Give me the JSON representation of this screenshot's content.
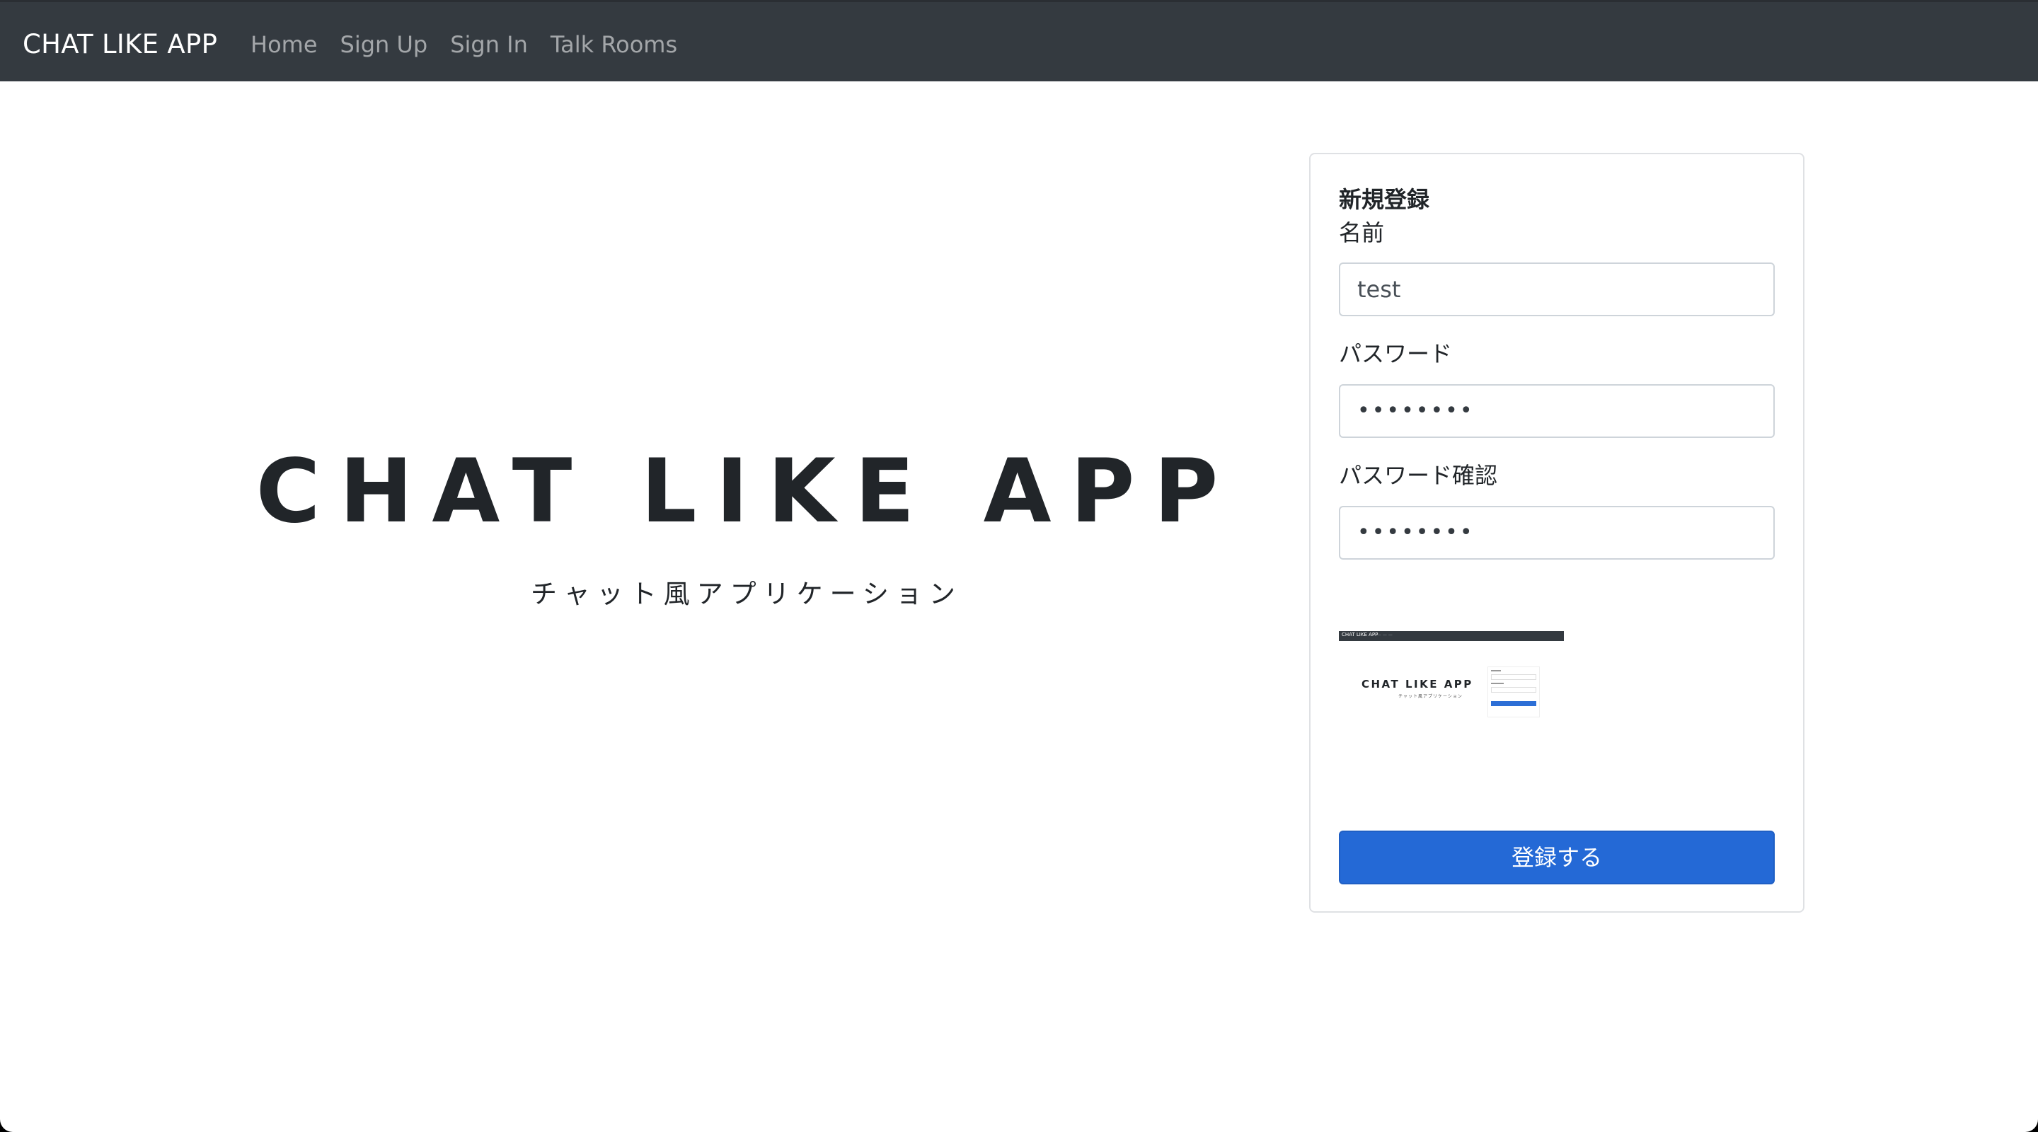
{
  "navbar": {
    "brand": "CHAT LIKE APP",
    "links": [
      "Home",
      "Sign Up",
      "Sign In",
      "Talk Rooms"
    ]
  },
  "hero": {
    "title": "CHAT LIKE APP",
    "subtitle": "チャット風アプリケーション"
  },
  "signup_form": {
    "title": "新規登録",
    "name_label": "名前",
    "name_value": "test",
    "password_label": "パスワード",
    "password_value": "••••••••",
    "password_confirm_label": "パスワード確認",
    "password_confirm_value": "••••••••",
    "preview": {
      "brand": "CHAT LIKE APP",
      "title": "CHAT LIKE APP",
      "subtitle": "チャット風アプリケーション"
    },
    "submit_label": "登録する"
  },
  "colors": {
    "navbar_bg": "#343a40",
    "primary_button": "#2469d6",
    "text": "#212529"
  }
}
